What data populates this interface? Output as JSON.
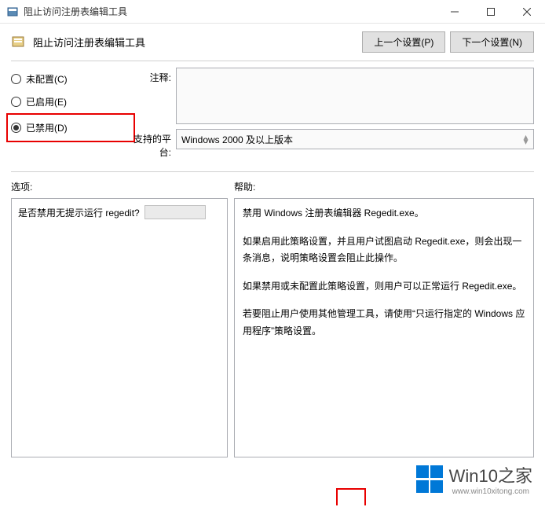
{
  "titlebar": {
    "title": "阻止访问注册表编辑工具"
  },
  "header": {
    "title": "阻止访问注册表编辑工具",
    "prev_btn": "上一个设置(P)",
    "next_btn": "下一个设置(N)"
  },
  "radios": {
    "not_configured": "未配置(C)",
    "enabled": "已启用(E)",
    "disabled": "已禁用(D)"
  },
  "fields": {
    "comment_label": "注释:",
    "comment_value": "",
    "platform_label": "支持的平台:",
    "platform_value": "Windows 2000 及以上版本"
  },
  "sections": {
    "options_label": "选项:",
    "help_label": "帮助:"
  },
  "options_panel": {
    "question": "是否禁用无提示运行 regedit?"
  },
  "help": {
    "p1": "禁用 Windows 注册表编辑器 Regedit.exe。",
    "p2": "如果启用此策略设置，并且用户试图启动 Regedit.exe，则会出现一条消息，说明策略设置会阻止此操作。",
    "p3": "如果禁用或未配置此策略设置，则用户可以正常运行 Regedit.exe。",
    "p4": "若要阻止用户使用其他管理工具，请使用“只运行指定的 Windows 应用程序”策略设置。"
  },
  "watermark": {
    "brand": "Win10",
    "suffix": "之家",
    "url": "www.win10xitong.com"
  }
}
